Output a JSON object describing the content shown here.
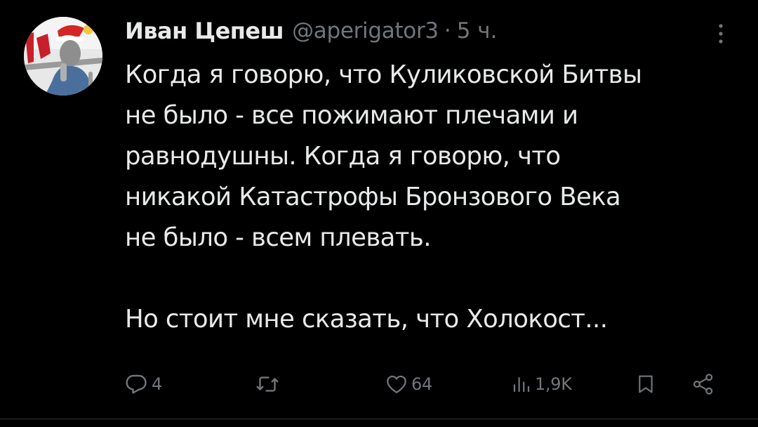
{
  "author": {
    "display_name": "Иван Цепеш",
    "handle": "@aperigator3",
    "separator": "·",
    "time": "5 ч."
  },
  "tweet": {
    "paragraphs": [
      "Когда я говорю, что Куликовской Битвы\nне было - все пожимают плечами и\nравнодушны. Когда я говорю, что\nникакой Катастрофы Бронзового Века\nне было - всем плевать.",
      "Но стоит мне сказать, что Холокост..."
    ]
  },
  "actions": {
    "replies": "4",
    "retweets": "",
    "likes": "64",
    "views": "1,9K"
  },
  "icons": {
    "more": "more-vertical-icon",
    "reply": "reply-icon",
    "retweet": "retweet-icon",
    "like": "heart-icon",
    "views": "views-icon",
    "bookmark": "bookmark-icon",
    "share": "share-icon"
  },
  "colors": {
    "background": "#000000",
    "text": "#e7e9ea",
    "secondary": "#71767b"
  }
}
